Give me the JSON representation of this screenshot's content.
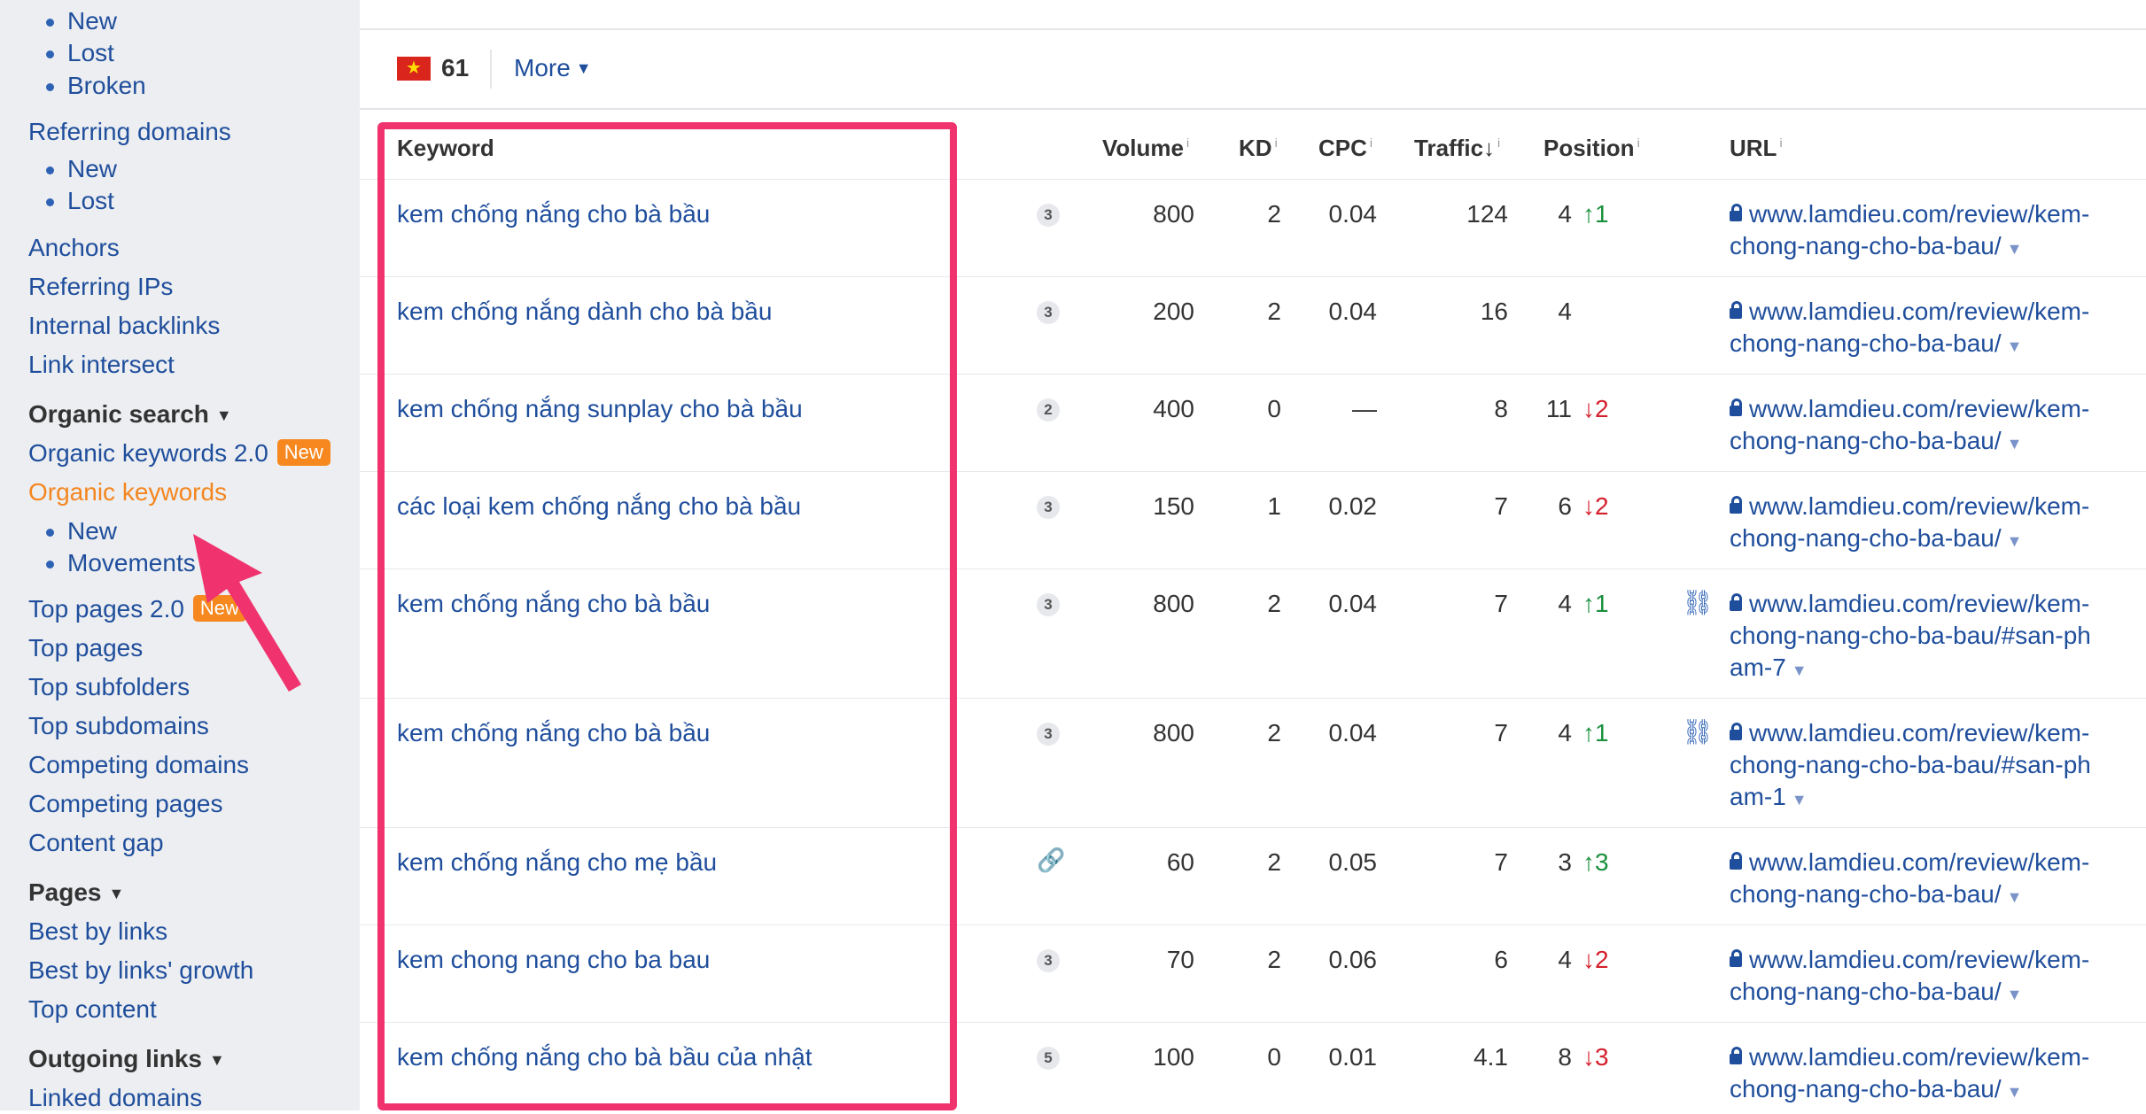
{
  "sidebar": {
    "backlinks_sub": [
      "New",
      "Lost",
      "Broken"
    ],
    "referring_domains": "Referring domains",
    "referring_sub": [
      "New",
      "Lost"
    ],
    "anchors": "Anchors",
    "referring_ips": "Referring IPs",
    "internal_backlinks": "Internal backlinks",
    "link_intersect": "Link intersect",
    "organic_search": "Organic search",
    "organic_keywords_2": "Organic keywords 2.0",
    "new_badge": "New",
    "organic_keywords": "Organic keywords",
    "organic_sub": [
      "New",
      "Movements"
    ],
    "top_pages_2": "Top pages 2.0",
    "top_pages": "Top pages",
    "top_subfolders": "Top subfolders",
    "top_subdomains": "Top subdomains",
    "competing_domains": "Competing domains",
    "competing_pages": "Competing pages",
    "content_gap": "Content gap",
    "pages": "Pages",
    "best_by_links": "Best by links",
    "best_by_links_growth": "Best by links' growth",
    "top_content": "Top content",
    "outgoing_links": "Outgoing links",
    "linked_domains": "Linked domains"
  },
  "filterbar": {
    "flag_icon": "vietnam-flag-icon",
    "country_count": "61",
    "more_label": "More"
  },
  "table": {
    "headers": {
      "keyword": "Keyword",
      "volume": "Volume",
      "kd": "KD",
      "cpc": "CPC",
      "traffic": "Traffic",
      "position": "Position",
      "url": "URL"
    },
    "info_mark": "i",
    "sort_arrow": "↓",
    "rows": [
      {
        "keyword": "kem chống nắng cho bà bầu",
        "serp": "3",
        "volume": "800",
        "kd": "2",
        "cpc": "0.04",
        "traffic": "124",
        "position": "4",
        "change": "↑1",
        "url": "www.lamdieu.com/review/kem-chong-nang-cho-ba-bau/"
      },
      {
        "keyword": "kem chống nắng dành cho bà bầu",
        "serp": "3",
        "volume": "200",
        "kd": "2",
        "cpc": "0.04",
        "traffic": "16",
        "position": "4",
        "change": "",
        "url": "www.lamdieu.com/review/kem-chong-nang-cho-ba-bau/"
      },
      {
        "keyword": "kem chống nắng sunplay cho bà bầu",
        "serp": "2",
        "volume": "400",
        "kd": "0",
        "cpc": "—",
        "traffic": "8",
        "position": "11",
        "change": "↓2",
        "url": "www.lamdieu.com/review/kem-chong-nang-cho-ba-bau/"
      },
      {
        "keyword": "các loại kem chống nắng cho bà bầu",
        "serp": "3",
        "volume": "150",
        "kd": "1",
        "cpc": "0.02",
        "traffic": "7",
        "position": "6",
        "change": "↓2",
        "url": "www.lamdieu.com/review/kem-chong-nang-cho-ba-bau/"
      },
      {
        "keyword": "kem chống nắng cho bà bầu",
        "serp": "3",
        "volume": "800",
        "kd": "2",
        "cpc": "0.04",
        "traffic": "7",
        "position": "4",
        "change": "↑1",
        "url": "www.lamdieu.com/review/kem-chong-nang-cho-ba-bau/#san-pham-7"
      },
      {
        "keyword": "kem chống nắng cho bà bầu",
        "serp": "3",
        "volume": "800",
        "kd": "2",
        "cpc": "0.04",
        "traffic": "7",
        "position": "4",
        "change": "↑1",
        "url": "www.lamdieu.com/review/kem-chong-nang-cho-ba-bau/#san-pham-1"
      },
      {
        "keyword": "kem chống nắng cho mẹ bầu",
        "serp": "",
        "volume": "60",
        "kd": "2",
        "cpc": "0.05",
        "traffic": "7",
        "position": "3",
        "change": "↑3",
        "url": "www.lamdieu.com/review/kem-chong-nang-cho-ba-bau/"
      },
      {
        "keyword": "kem chong nang cho ba bau",
        "serp": "3",
        "volume": "70",
        "kd": "2",
        "cpc": "0.06",
        "traffic": "6",
        "position": "4",
        "change": "↓2",
        "url": "www.lamdieu.com/review/kem-chong-nang-cho-ba-bau/"
      },
      {
        "keyword": "kem chống nắng cho bà bầu của nhật",
        "serp": "5",
        "volume": "100",
        "kd": "0",
        "cpc": "0.01",
        "traffic": "4.1",
        "position": "8",
        "change": "↓3",
        "url": "www.lamdieu.com/review/kem-chong-nang-cho-ba-bau/"
      }
    ]
  },
  "colors": {
    "highlight": "#f0336e",
    "link": "#1f4e9c",
    "active": "#f4861f",
    "up": "#1a8f3c",
    "down": "#d4202c"
  }
}
